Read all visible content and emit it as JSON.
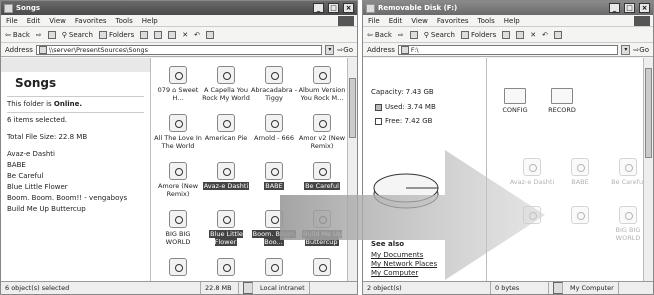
{
  "left": {
    "title": "Songs",
    "menu": [
      "File",
      "Edit",
      "View",
      "Favorites",
      "Tools",
      "Help"
    ],
    "toolbar": {
      "back": "Back",
      "search": "Search",
      "folders": "Folders"
    },
    "address_label": "Address",
    "address_value": "\\\\server\\PresentSources\\Songs",
    "go": "Go",
    "panel": {
      "heading": "Songs",
      "online_prefix": "This folder is ",
      "online_state": "Online.",
      "items_selected": "6 items selected.",
      "total_size": "Total File Size: 22.8 MB",
      "files": [
        "Avaz-e Dashti",
        "BABE",
        "Be Careful",
        "Blue Little Flower",
        "Boom. Boom. Boom!! - vengaboys",
        "Build Me Up Buttercup"
      ]
    },
    "items": [
      {
        "label": "079 ⌂ Sweet H...",
        "selected": false
      },
      {
        "label": "A Capella You Rock My World",
        "selected": false
      },
      {
        "label": "Abracadabra - Tiggy",
        "selected": false
      },
      {
        "label": "Album Version You Rock M...",
        "selected": false
      },
      {
        "label": "All The Love In The World",
        "selected": false
      },
      {
        "label": "American Pie",
        "selected": false
      },
      {
        "label": "Arnold - 666",
        "selected": false
      },
      {
        "label": "Amor v2 (New Remix)",
        "selected": false
      },
      {
        "label": "Amore (New Remix)",
        "selected": false
      },
      {
        "label": "Avaz-e Dashti",
        "selected": true
      },
      {
        "label": "BABE",
        "selected": true
      },
      {
        "label": "Be Careful",
        "selected": true
      },
      {
        "label": "BIG BIG WORLD",
        "selected": false
      },
      {
        "label": "Blue Little Flower",
        "selected": true
      },
      {
        "label": "Boom. Boom. Boo...",
        "selected": true
      },
      {
        "label": "Build Me Up Buttercup",
        "selected": true
      }
    ],
    "status": {
      "objects": "6 object(s) selected",
      "size": "22.8 MB",
      "zone": "Local intranet"
    }
  },
  "right": {
    "title": "Removable Disk (F:)",
    "menu": [
      "File",
      "Edit",
      "View",
      "Favorites",
      "Tools",
      "Help"
    ],
    "toolbar": {
      "back": "Back",
      "search": "Search",
      "folders": "Folders"
    },
    "address_label": "Address",
    "address_value": "F:\\",
    "go": "Go",
    "panel": {
      "capacity": "Capacity: 7.43 GB",
      "used": "Used: 3.74 MB",
      "free": "Free: 7.42 GB",
      "see_also": "See also",
      "links": [
        "My Documents",
        "My Network Places",
        "My Computer"
      ]
    },
    "folders": [
      "CONFIG",
      "RECORD"
    ],
    "ghost_items": [
      "Avaz-e Dashti",
      "BABE",
      "Be Careful",
      "",
      "",
      "BIG BIG WORLD"
    ],
    "status": {
      "objects": "2 object(s)",
      "size": "0 bytes",
      "zone": "My Computer"
    }
  }
}
